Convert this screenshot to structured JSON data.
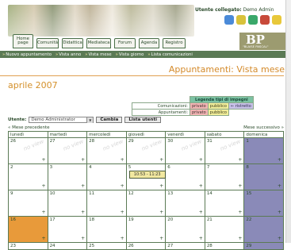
{
  "header": {
    "utente_label": "Utente collegato:",
    "utente_name": "Demo Admin",
    "logo_mark": "BP",
    "logo_text": "\"BLAISE PASCAL\"",
    "toolbar_icons": [
      "users-icon",
      "pie-chart-icon",
      "globe-icon",
      "gear-icon",
      "smiley-icon"
    ],
    "icon_colors": [
      "#4a8ad8",
      "#d8c23a",
      "#3aa86a",
      "#c84a3a",
      "#e8c83a"
    ]
  },
  "nav": {
    "tabs": [
      "Home page",
      "Comunità",
      "Didattica",
      "Mediateca",
      "Forum",
      "Agenda",
      "Registro"
    ]
  },
  "subnav": {
    "items": [
      "Nuovo appuntamento",
      "Vista anno",
      "Vista mese",
      "Vista giorno",
      "Lista comunicazioni"
    ]
  },
  "page": {
    "app_title": "Appuntamenti: Vista mese",
    "month_title": "aprile 2007"
  },
  "legend": {
    "title": "Legenda tipi di impegni",
    "rows": [
      {
        "label": "Comunicazioni:",
        "private": "privato",
        "public": "pubblico",
        "restricted": "ristretto"
      },
      {
        "label": "Appuntamenti:",
        "private": "privato",
        "public": "pubblico",
        "restricted": ""
      }
    ]
  },
  "filter": {
    "label": "Utente:",
    "selected": "Demo Administrator",
    "change_button": "Cambia",
    "list_button": "Lista utenti"
  },
  "calendar": {
    "prev_label": "« Mese precedente",
    "next_label": "Mese successivo »",
    "weekdays": [
      "lunedì",
      "martedì",
      "mercoledì",
      "giovedì",
      "venerdì",
      "sabato",
      "domenica"
    ],
    "watermark": "no view",
    "weeks": [
      [
        "26",
        "27",
        "28",
        "29",
        "30",
        "31",
        "1"
      ],
      [
        "2",
        "3",
        "4",
        "5",
        "6",
        "7",
        "8"
      ],
      [
        "9",
        "10",
        "11",
        "12",
        "13",
        "14",
        "15"
      ],
      [
        "16",
        "17",
        "18",
        "19",
        "20",
        "21",
        "22"
      ],
      [
        "23",
        "24",
        "25",
        "26",
        "27",
        "28",
        "29"
      ]
    ],
    "appointment": "10:53 - 11:23",
    "plus": "+"
  },
  "colors": {
    "nav_green": "#5b7a55",
    "accent_orange": "#d48a2a",
    "sunday": "#8a8ab8",
    "today": "#e89a3a",
    "appointment": "#f2e8a0"
  }
}
